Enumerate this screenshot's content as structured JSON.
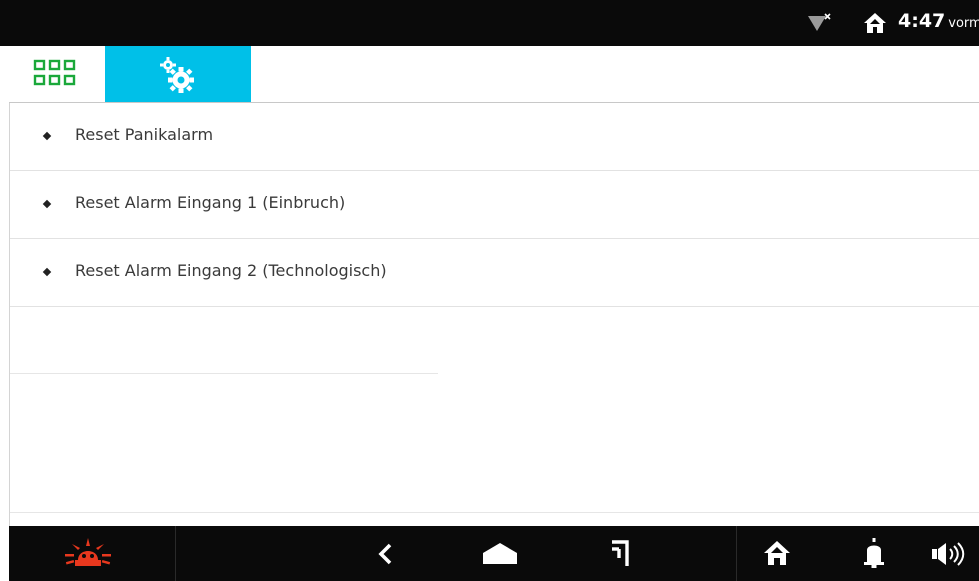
{
  "status_bar": {
    "time": "4:47",
    "time_suffix": "vorm",
    "icons": [
      "wifi-off-icon",
      "home-icon"
    ]
  },
  "tabs": [
    {
      "name": "apps",
      "icon": "app-grid-icon",
      "active": false,
      "icon_color": "#1aa83a"
    },
    {
      "name": "settings",
      "icon": "gears-icon",
      "active": true,
      "background": "#00c0e8"
    }
  ],
  "menu": {
    "items": [
      {
        "label": "Reset Panikalarm"
      },
      {
        "label": "Reset Alarm Eingang 1 (Einbruch)"
      },
      {
        "label": "Reset Alarm Eingang 2 (Technologisch)"
      }
    ]
  },
  "nav_bar": {
    "buttons": [
      {
        "name": "alarm",
        "icon": "alarm-siren-icon",
        "color": "#e8381e"
      },
      {
        "name": "back",
        "icon": "chevron-left-icon"
      },
      {
        "name": "home",
        "icon": "home-shape-icon"
      },
      {
        "name": "recent",
        "icon": "recent-apps-icon"
      },
      {
        "name": "house",
        "icon": "house-icon"
      },
      {
        "name": "notifications",
        "icon": "bell-icon"
      },
      {
        "name": "volume",
        "icon": "speaker-icon"
      }
    ]
  }
}
